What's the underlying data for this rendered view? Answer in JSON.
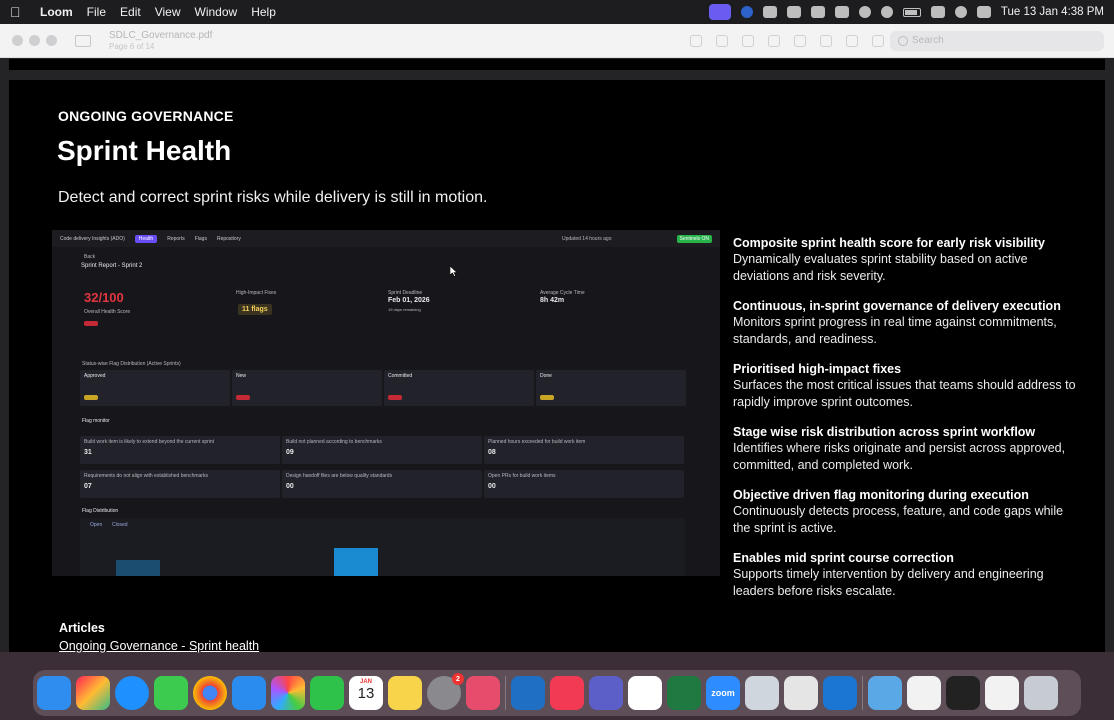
{
  "menubar": {
    "app_name": "Loom",
    "menus": [
      "File",
      "Edit",
      "View",
      "Window",
      "Help"
    ],
    "clock": "Tue 13 Jan  4:38 PM"
  },
  "viewer": {
    "doc_title": "SDLC_Governance.pdf",
    "page_indicator": "Page 6 of 14",
    "search_placeholder": "Search"
  },
  "slide": {
    "eyebrow": "ONGOING GOVERNANCE",
    "title": "Sprint Health",
    "subtitle": "Detect and correct sprint risks while delivery is still in motion.",
    "screenshot": {
      "app_title": "Code delivery Insights (ADO)",
      "nav": [
        "Health",
        "Reports",
        "Flags",
        "Repository"
      ],
      "updated": "Updated 14 hours ago",
      "status_pill": "Sentinels ON",
      "back": "Back",
      "report_title": "Sprint Report - Sprint 2",
      "score": "32/100",
      "score_label": "Overall Health Score",
      "high_impact_label": "High-Impact Fixes",
      "high_impact_value": "11 flags",
      "deadline_label": "Sprint Deadline",
      "deadline_value": "Feb 01, 2026",
      "deadline_sub": "19 days remaining",
      "cycle_label": "Average Cycle Time",
      "cycle_value": "8h 42m",
      "distribution_label": "Status-wise Flag Distribution (Active Sprints)",
      "columns": [
        "Approved",
        "New",
        "Committed",
        "Done"
      ],
      "flag_monitor_label": "Flag monitor",
      "monitors": [
        {
          "label": "Build work item is likely to extend beyond the current sprint",
          "value": "31"
        },
        {
          "label": "Build not planned according to benchmarks",
          "value": "09"
        },
        {
          "label": "Planned hours exceeded for build work item",
          "value": "08"
        },
        {
          "label": "Requirements do not align with established benchmarks",
          "value": "07"
        },
        {
          "label": "Design handoff files are below quality standards",
          "value": "00"
        },
        {
          "label": "Open PRs for build work items",
          "value": "00"
        }
      ],
      "flag_distribution_label": "Flag Distribution",
      "legend": [
        "Open",
        "Closed"
      ]
    },
    "features": [
      {
        "title": "Composite sprint health score for early risk visibility",
        "body": "Dynamically evaluates sprint stability based on active deviations and risk severity."
      },
      {
        "title": "Continuous, in-sprint governance of delivery execution",
        "body": "Monitors sprint progress in real time against commitments, standards, and readiness."
      },
      {
        "title": "Prioritised high-impact fixes",
        "body": "Surfaces the most critical issues that teams should address to rapidly improve sprint outcomes."
      },
      {
        "title": "Stage wise risk distribution across sprint workflow",
        "body": " Identifies where risks originate and persist across approved, committed, and completed work."
      },
      {
        "title": "Objective driven flag monitoring during execution",
        "body": "Continuously detects process, feature, and code gaps while the sprint is active."
      },
      {
        "title": "Enables mid sprint course correction",
        "body": "Supports timely intervention by delivery and engineering leaders before risks escalate."
      }
    ],
    "articles_label": "Articles",
    "article_link": "Ongoing Governance - Sprint health"
  },
  "dock": {
    "calendar_month": "JAN",
    "calendar_day": "13",
    "settings_badge": "2",
    "zoom_label": "zoom"
  }
}
